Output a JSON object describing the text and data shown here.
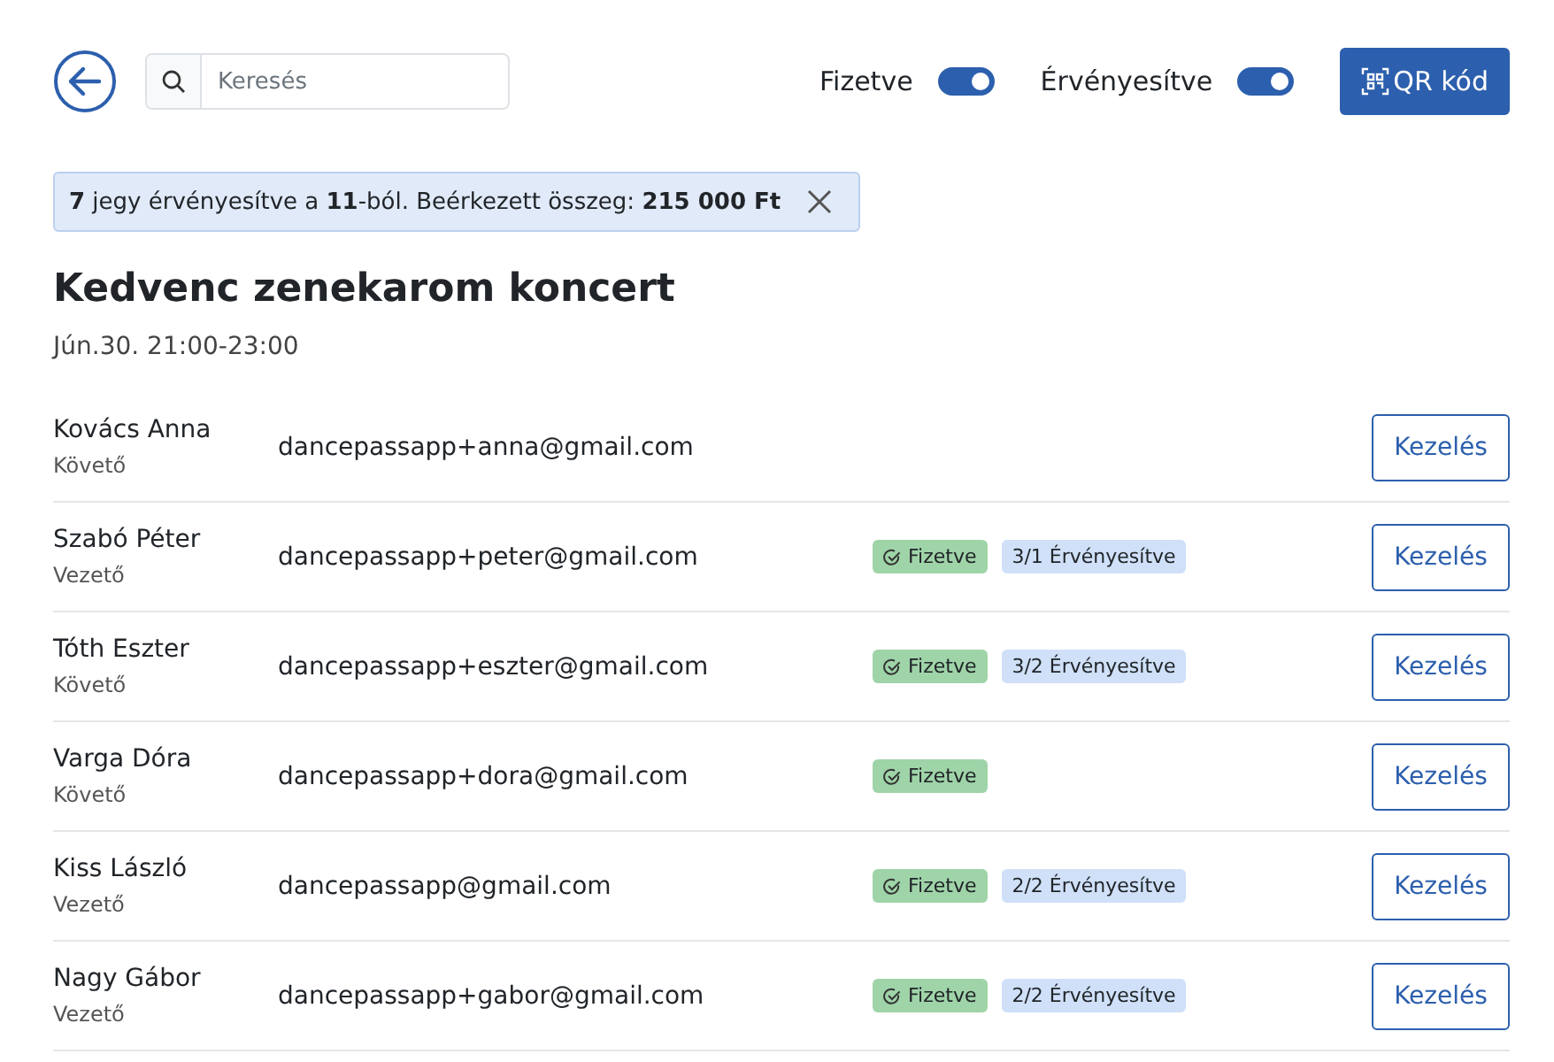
{
  "toolbar": {
    "search": {
      "placeholder": "Keresés"
    },
    "toggles": [
      {
        "label": "Fizetve",
        "on": true
      },
      {
        "label": "Érvényesítve",
        "on": true
      }
    ],
    "qr_button": "QR kód"
  },
  "alert": {
    "text": "**7** jegy érvényesítve a **11**-ból. Beérkezett összeg: **215 000 Ft**"
  },
  "event": {
    "title": "Kedvenc zenekarom koncert",
    "time": "Jún.30. 21:00-23:00"
  },
  "attendees": [
    {
      "name": "Kovács Anna",
      "role": "Követő",
      "email": "dancepassapp+anna@gmail.com",
      "paid": false,
      "action": "Kezelés"
    },
    {
      "name": "Szabó Péter",
      "role": "Vezető",
      "email": "dancepassapp+peter@gmail.com",
      "paid": true,
      "paid_label": "Fizetve",
      "validated": "3/1 Érvényesítve",
      "action": "Kezelés"
    },
    {
      "name": "Tóth Eszter",
      "role": "Követő",
      "email": "dancepassapp+eszter@gmail.com",
      "paid": true,
      "paid_label": "Fizetve",
      "validated": "3/2 Érvényesítve",
      "action": "Kezelés"
    },
    {
      "name": "Varga Dóra",
      "role": "Követő",
      "email": "dancepassapp+dora@gmail.com",
      "paid": true,
      "paid_label": "Fizetve",
      "action": "Kezelés"
    },
    {
      "name": "Kiss László",
      "role": "Vezető",
      "email": "dancepassapp@gmail.com",
      "paid": true,
      "paid_label": "Fizetve",
      "validated": "2/2 Érvényesítve",
      "action": "Kezelés"
    },
    {
      "name": "Nagy Gábor",
      "role": "Vezető",
      "email": "dancepassapp+gabor@gmail.com",
      "paid": true,
      "paid_label": "Fizetve",
      "validated": "2/2 Érvényesítve",
      "action": "Kezelés"
    }
  ]
}
